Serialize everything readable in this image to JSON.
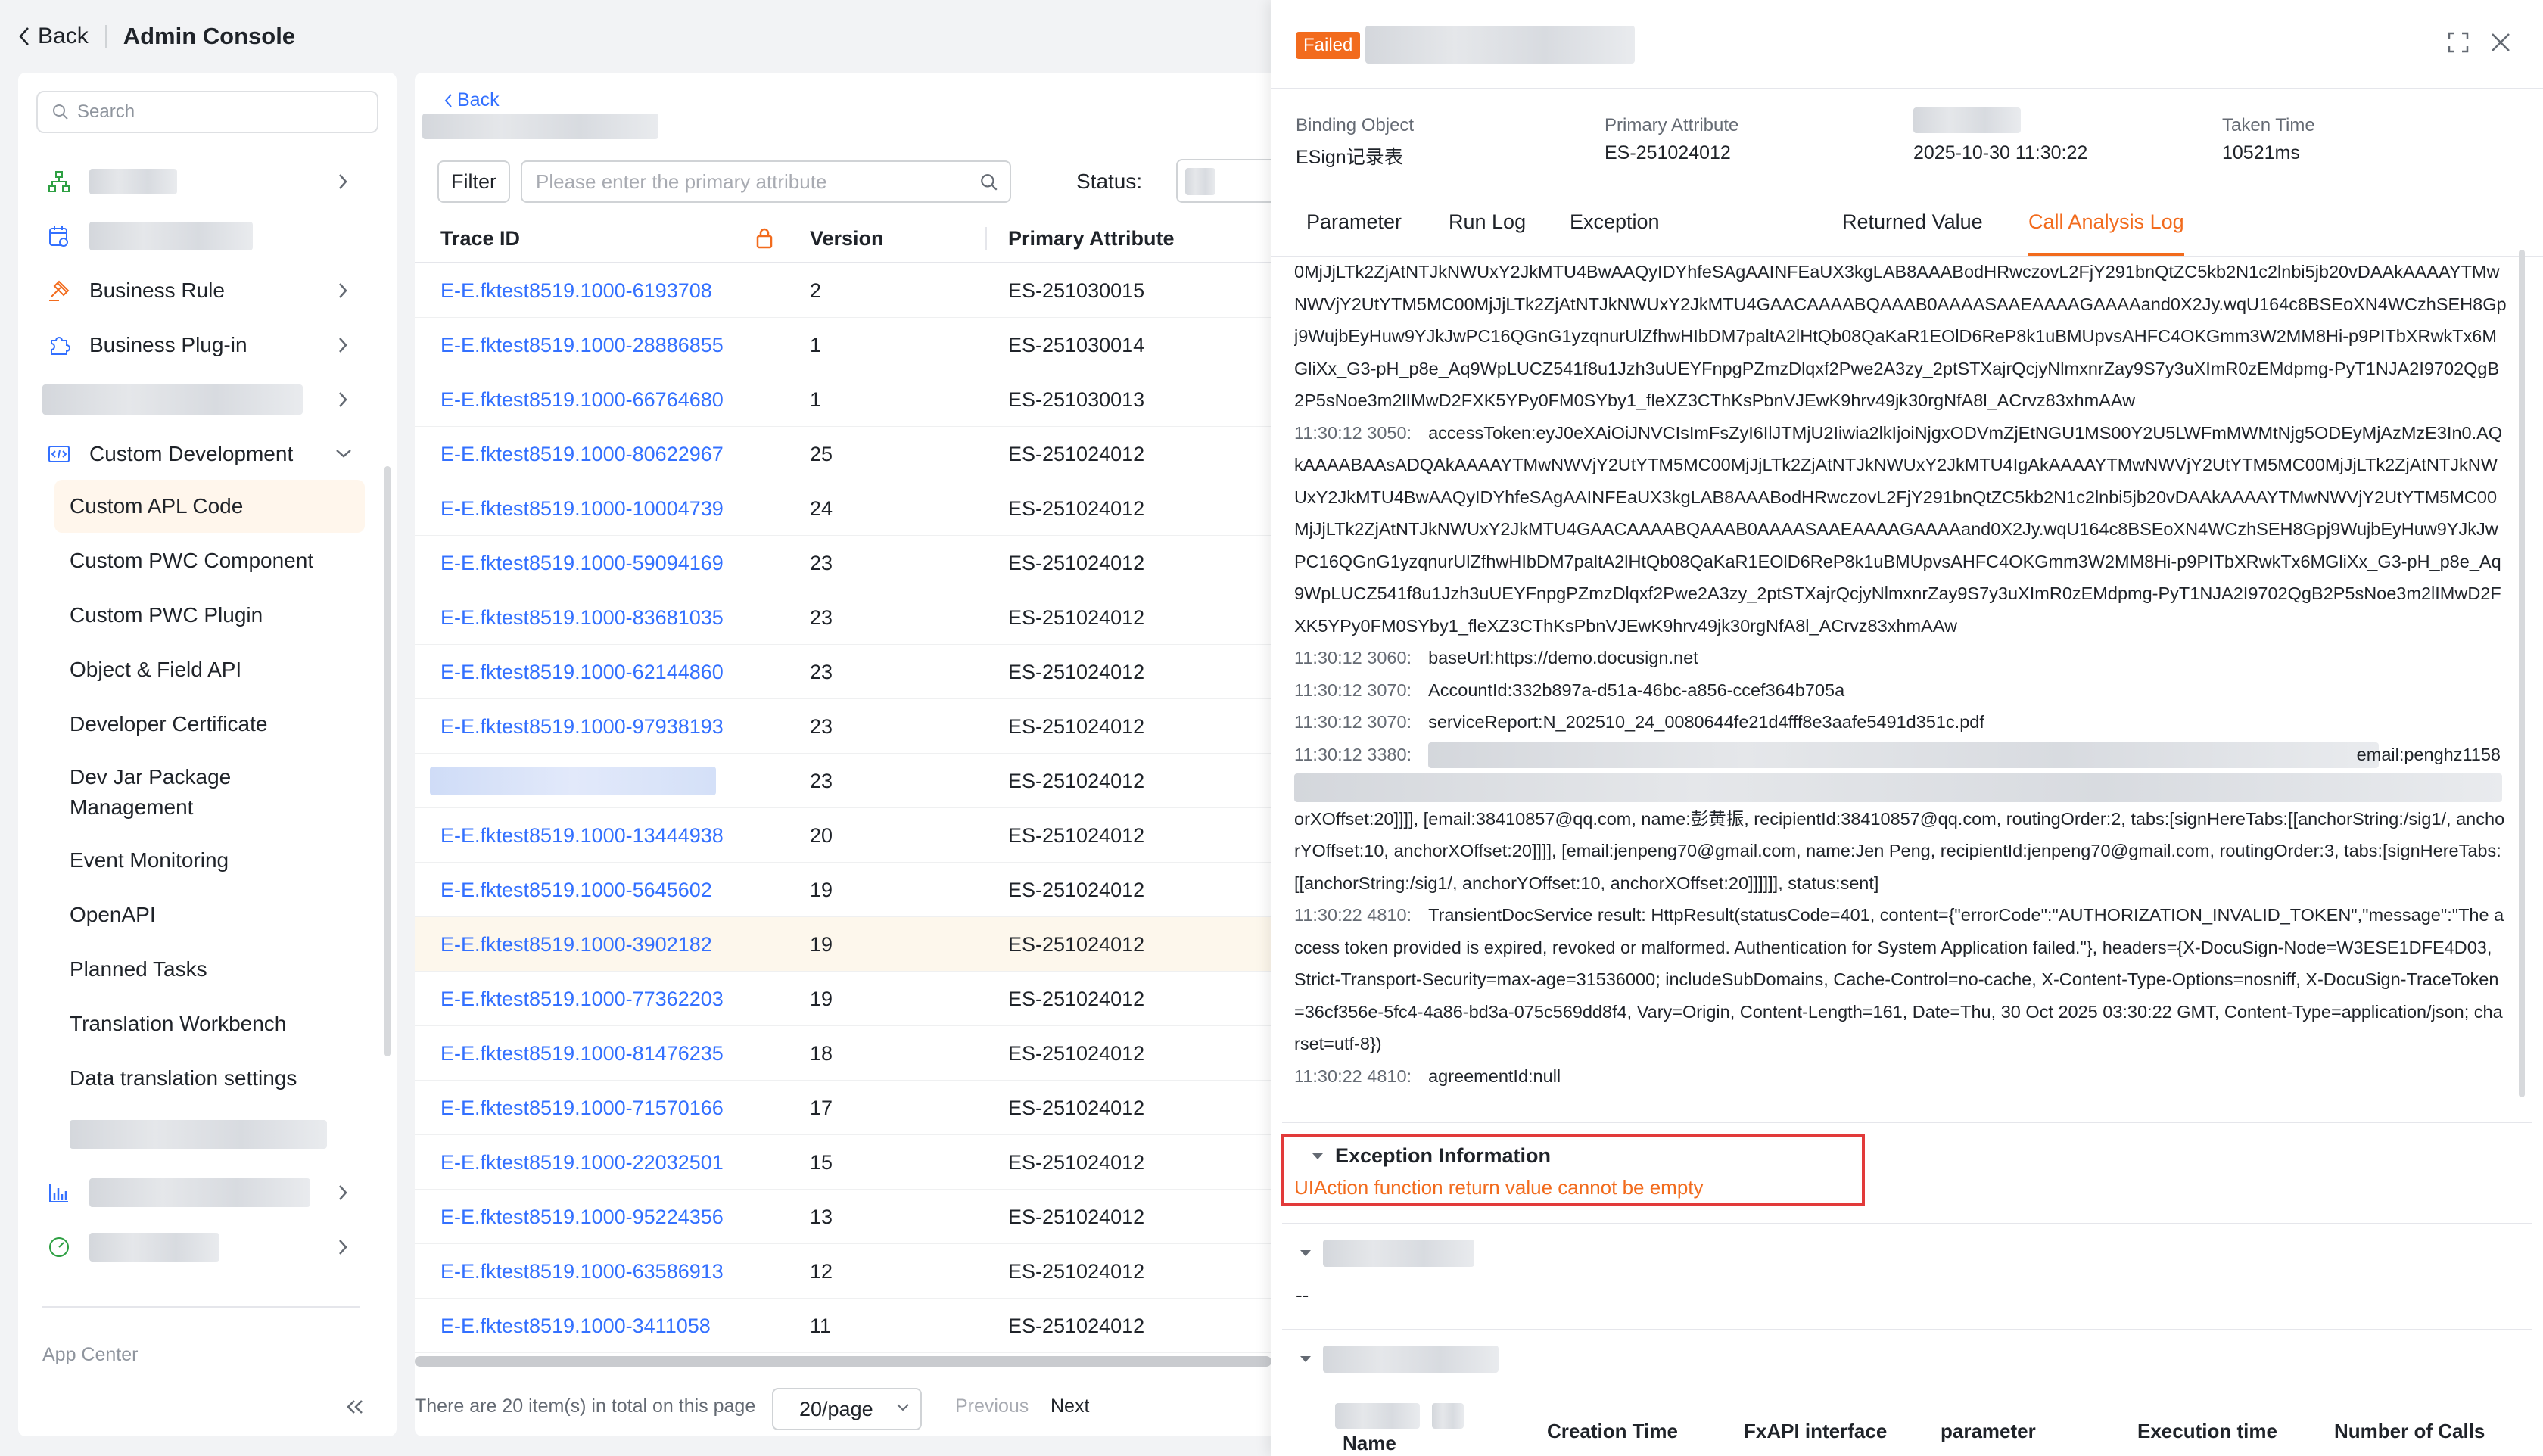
{
  "topbar": {
    "back": "Back",
    "title": "Admin Console"
  },
  "sidebar": {
    "search_placeholder": "Search",
    "items": [
      {
        "label": "Business Rule",
        "icon": "rule-icon"
      },
      {
        "label": "Business Plug-in",
        "icon": "plugin-icon"
      },
      {
        "label": "Custom Development",
        "icon": "code-icon"
      }
    ],
    "sub_items": [
      "Custom APL Code",
      "Custom PWC Component",
      "Custom PWC Plugin",
      "Object & Field API",
      "Developer Certificate",
      "Dev Jar Package Management",
      "Event Monitoring",
      "OpenAPI",
      "Planned Tasks",
      "Translation Workbench",
      "Data translation settings"
    ],
    "app_center": "App Center"
  },
  "main": {
    "back": "Back",
    "filter": "Filter",
    "filter_placeholder": "Please enter the primary attribute",
    "status_label": "Status:",
    "columns": [
      "Trace ID",
      "Version",
      "Primary Attribute"
    ],
    "rows": [
      {
        "trace": "E-E.fktest8519.1000-6193708",
        "version": "2",
        "attr": "ES-251030015"
      },
      {
        "trace": "E-E.fktest8519.1000-28886855",
        "version": "1",
        "attr": "ES-251030014"
      },
      {
        "trace": "E-E.fktest8519.1000-66764680",
        "version": "1",
        "attr": "ES-251030013"
      },
      {
        "trace": "E-E.fktest8519.1000-80622967",
        "version": "25",
        "attr": "ES-251024012"
      },
      {
        "trace": "E-E.fktest8519.1000-10004739",
        "version": "24",
        "attr": "ES-251024012"
      },
      {
        "trace": "E-E.fktest8519.1000-59094169",
        "version": "23",
        "attr": "ES-251024012"
      },
      {
        "trace": "E-E.fktest8519.1000-83681035",
        "version": "23",
        "attr": "ES-251024012"
      },
      {
        "trace": "E-E.fktest8519.1000-62144860",
        "version": "23",
        "attr": "ES-251024012"
      },
      {
        "trace": "E-E.fktest8519.1000-97938193",
        "version": "23",
        "attr": "ES-251024012"
      },
      {
        "trace": "",
        "version": "23",
        "attr": "ES-251024012"
      },
      {
        "trace": "E-E.fktest8519.1000-13444938",
        "version": "20",
        "attr": "ES-251024012"
      },
      {
        "trace": "E-E.fktest8519.1000-5645602",
        "version": "19",
        "attr": "ES-251024012"
      },
      {
        "trace": "E-E.fktest8519.1000-3902182",
        "version": "19",
        "attr": "ES-251024012"
      },
      {
        "trace": "E-E.fktest8519.1000-77362203",
        "version": "19",
        "attr": "ES-251024012"
      },
      {
        "trace": "E-E.fktest8519.1000-81476235",
        "version": "18",
        "attr": "ES-251024012"
      },
      {
        "trace": "E-E.fktest8519.1000-71570166",
        "version": "17",
        "attr": "ES-251024012"
      },
      {
        "trace": "E-E.fktest8519.1000-22032501",
        "version": "15",
        "attr": "ES-251024012"
      },
      {
        "trace": "E-E.fktest8519.1000-95224356",
        "version": "13",
        "attr": "ES-251024012"
      },
      {
        "trace": "E-E.fktest8519.1000-63586913",
        "version": "12",
        "attr": "ES-251024012"
      },
      {
        "trace": "E-E.fktest8519.1000-3411058",
        "version": "11",
        "attr": "ES-251024012"
      }
    ],
    "footer": {
      "total": "There are 20 item(s) in total on this page",
      "page_size": "20/page",
      "prev": "Previous",
      "next": "Next"
    }
  },
  "drawer": {
    "status_badge": "Failed",
    "meta": [
      {
        "key": "Binding Object",
        "value": "ESign记录表"
      },
      {
        "key": "Primary Attribute",
        "value": "ES-251024012"
      },
      {
        "key": "",
        "value": "2025-10-30 11:30:22"
      },
      {
        "key": "Taken Time",
        "value": "10521ms"
      }
    ],
    "tabs": [
      "Parameter",
      "Run Log",
      "Exception",
      "Returned Value",
      "Call Analysis Log"
    ],
    "log_lines": [
      {
        "ts": "",
        "text": "0MjJjLTk2ZjAtNTJkNWUxY2JkMTU4BwAAQyIDYhfeSAgAAINFEaUX3kgLAB8AAABodHRwczovL2FjY291bnQtZC5kb2N1c2lnbi5jb20vDAAkAAAAYTMwNWVjY2UtYTM5MC00MjJjLTk2ZjAtNTJkNWUxY2JkMTU4GAACAAAABQAAAB0AAAASAAEAAAAGAAAAand0X2Jy.wqU164c8BSEoXN4WCzhSEH8Gpj9WujbEyHuw9YJkJwPC16QGnG1yzqnurUlZfhwHIbDM7paltA2lHtQb08QaKaR1EOlD6ReP8k1uBMUpvsAHFC4OKGmm3W2MM8Hi-p9PITbXRwkTx6MGliXx_G3-pH_p8e_Aq9WpLUCZ541f8u1Jzh3uUEYFnpgPZmzDlqxf2Pwe2A3zy_2ptSTXajrQcjyNlmxnrZay9S7y3uXImR0zEMdpmg-PyT1NJA2I9702QgB2P5sNoe3m2lIMwD2FXK5YPy0FM0SYby1_fleXZ3CThKsPbnVJEwK9hrv49jk30rgNfA8l_ACrvz83xhmAAw"
      },
      {
        "ts": "11:30:12 3050:",
        "text": "accessToken:eyJ0eXAiOiJNVCIsImFsZyI6IlJTMjU2Iiwia2lkIjoiNjgxODVmZjEtNGU1MS00Y2U5LWFmMWMtNjg5ODEyMjAzMzE3In0.AQkAAAABAAsADQAkAAAAYTMwNWVjY2UtYTM5MC00MjJjLTk2ZjAtNTJkNWUxY2JkMTU4IgAkAAAAYTMwNWVjY2UtYTM5MC00MjJjLTk2ZjAtNTJkNWUxY2JkMTU4BwAAQyIDYhfeSAgAAINFEaUX3kgLAB8AAABodHRwczovL2FjY291bnQtZC5kb2N1c2lnbi5jb20vDAAkAAAAYTMwNWVjY2UtYTM5MC00MjJjLTk2ZjAtNTJkNWUxY2JkMTU4GAACAAAABQAAAB0AAAASAAEAAAAGAAAAand0X2Jy.wqU164c8BSEoXN4WCzhSEH8Gpj9WujbEyHuw9YJkJwPC16QGnG1yzqnurUlZfhwHIbDM7paltA2lHtQb08QaKaR1EOlD6ReP8k1uBMUpvsAHFC4OKGmm3W2MM8Hi-p9PITbXRwkTx6MGliXx_G3-pH_p8e_Aq9WpLUCZ541f8u1Jzh3uUEYFnpgPZmzDlqxf2Pwe2A3zy_2ptSTXajrQcjyNlmxnrZay9S7y3uXImR0zEMdpmg-PyT1NJA2I9702QgB2P5sNoe3m2lIMwD2FXK5YPy0FM0SYby1_fleXZ3CThKsPbnVJEwK9hrv49jk30rgNfA8l_ACrvz83xhmAAw"
      },
      {
        "ts": "11:30:12 3060:",
        "text": "baseUrl:https://demo.docusign.net"
      },
      {
        "ts": "11:30:12 3070:",
        "text": "AccountId:332b897a-d51a-46bc-a856-ccef364b705a"
      },
      {
        "ts": "11:30:12 3070:",
        "text": "serviceReport:N_202510_24_0080644fe21d4fff8e3aafe5491d351c.pdf"
      }
    ],
    "log_blur_line": {
      "ts": "11:30:12 3380:",
      "text": "email:penghz1158"
    },
    "log_lines_2": [
      {
        "ts": "",
        "text": "orXOffset:20]]]], [email:38410857@qq.com, name:彭黄振, recipientId:38410857@qq.com, routingOrder:2, tabs:[signHereTabs:[[anchorString:/sig1/, anchorYOffset:10, anchorXOffset:20]]]], [email:jenpeng70@gmail.com, name:Jen Peng, recipientId:jenpeng70@gmail.com, routingOrder:3, tabs:[signHereTabs:[[anchorString:/sig1/, anchorYOffset:10, anchorXOffset:20]]]]]], status:sent]"
      },
      {
        "ts": "11:30:22 4810:",
        "text": "TransientDocService result: HttpResult(statusCode=401, content={\"errorCode\":\"AUTHORIZATION_INVALID_TOKEN\",\"message\":\"The access token provided is expired, revoked or malformed. Authentication for System Application failed.\"}, headers={X-DocuSign-Node=W3ESE1DFE4D03, Strict-Transport-Security=max-age=31536000; includeSubDomains, Cache-Control=no-cache, X-Content-Type-Options=nosniff, X-DocuSign-TraceToken=36cf356e-5fc4-4a86-bd3a-075c569dd8f4, Vary=Origin, Content-Length=161, Date=Thu, 30 Oct 2025 03:30:22 GMT, Content-Type=application/json; charset=utf-8})"
      },
      {
        "ts": "11:30:22 4810:",
        "text": "agreementId:null"
      }
    ],
    "exception": {
      "title": "Exception Information",
      "message": "UIAction function return value cannot be empty"
    },
    "section2_value": "--",
    "table_columns": [
      "Creation Time",
      "FxAPI interface",
      "parameter",
      "Execution time",
      "Number of Calls"
    ],
    "table_first_col_partial": "Name"
  }
}
